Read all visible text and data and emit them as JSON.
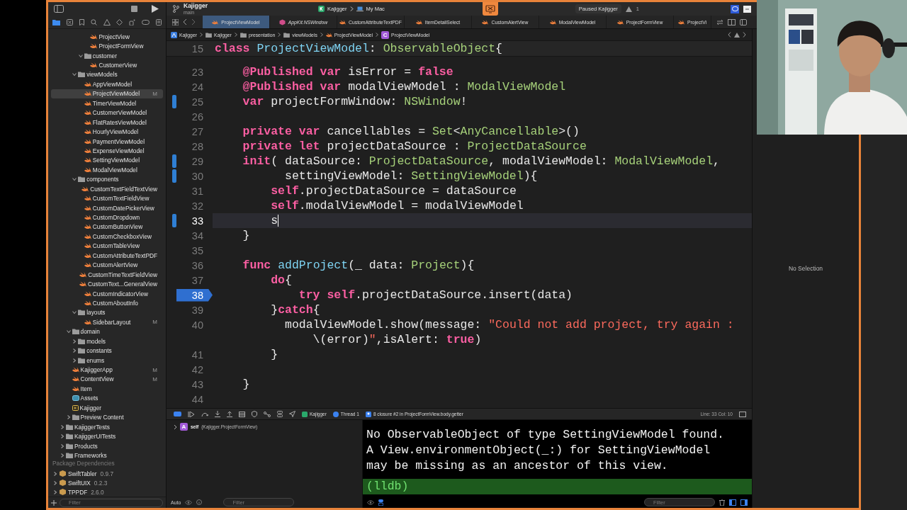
{
  "toolbar": {
    "project": "Kajigger",
    "branch": "main",
    "scheme": "Kajigger",
    "destination": "My Mac",
    "status": "Paused Kajigger",
    "warnings": "1"
  },
  "navigator": {
    "tree": [
      {
        "children": [
          {
            "children": [
              {
                "children": [
                  {
                    "children": [
                      {
                        "name": "ProjectView",
                        "kind": "swift",
                        "selected": false
                      },
                      {
                        "name": "ProjectFormView",
                        "kind": "swift",
                        "selected": false
                      }
                    ]
                  },
                  {
                    "name": "customer",
                    "kind": "folder",
                    "expanded": true,
                    "selected": false,
                    "children": [
                      {
                        "name": "CustomerView",
                        "kind": "swift",
                        "selected": false
                      }
                    ]
                  }
                ]
              },
              {
                "name": "viewModels",
                "kind": "folder",
                "expanded": true,
                "selected": false,
                "children": [
                  {
                    "name": "AppViewModel",
                    "kind": "swift",
                    "selected": false
                  },
                  {
                    "name": "ProjectViewModel",
                    "kind": "swift",
                    "selected": true,
                    "badge": "M"
                  },
                  {
                    "name": "TimerViewModel",
                    "kind": "swift",
                    "selected": false
                  },
                  {
                    "name": "CustomerViewModel",
                    "kind": "swift",
                    "selected": false
                  },
                  {
                    "name": "FlatRatesViewModel",
                    "kind": "swift",
                    "selected": false
                  },
                  {
                    "name": "HourlyViewModel",
                    "kind": "swift",
                    "selected": false
                  },
                  {
                    "name": "PaymentViewModel",
                    "kind": "swift",
                    "selected": false
                  },
                  {
                    "name": "ExpenseViewModel",
                    "kind": "swift",
                    "selected": false
                  },
                  {
                    "name": "SettingViewModel",
                    "kind": "swift",
                    "selected": false
                  },
                  {
                    "name": "ModalViewModel",
                    "kind": "swift",
                    "selected": false
                  }
                ]
              },
              {
                "name": "components",
                "kind": "folder",
                "expanded": true,
                "selected": false,
                "children": [
                  {
                    "name": "CustomTextFieldTextView",
                    "kind": "swift",
                    "selected": false
                  },
                  {
                    "name": "CustomTextFieldView",
                    "kind": "swift",
                    "selected": false
                  },
                  {
                    "name": "CustomDatePickerView",
                    "kind": "swift",
                    "selected": false
                  },
                  {
                    "name": "CustomDropdown",
                    "kind": "swift",
                    "selected": false
                  },
                  {
                    "name": "CustomButtonView",
                    "kind": "swift",
                    "selected": false
                  },
                  {
                    "name": "CustomCheckboxView",
                    "kind": "swift",
                    "selected": false
                  },
                  {
                    "name": "CustomTableView",
                    "kind": "swift",
                    "selected": false
                  },
                  {
                    "name": "CustomAttributeTextPDF",
                    "kind": "swift",
                    "selected": false
                  },
                  {
                    "name": "CustomAlertView",
                    "kind": "swift",
                    "selected": false
                  },
                  {
                    "name": "CustomTimeTextFieldView",
                    "kind": "swift",
                    "selected": false
                  },
                  {
                    "name": "CustomText...GeneralView",
                    "kind": "swift",
                    "selected": false
                  },
                  {
                    "name": "CustomIndicatorView",
                    "kind": "swift",
                    "selected": false
                  },
                  {
                    "name": "CustomAboutInfo",
                    "kind": "swift",
                    "selected": false
                  }
                ]
              },
              {
                "name": "layouts",
                "kind": "folder",
                "expanded": true,
                "selected": false,
                "children": [
                  {
                    "name": "SidebarLayout",
                    "kind": "swift",
                    "selected": false,
                    "badge": "M"
                  }
                ]
              }
            ]
          },
          {
            "name": "domain",
            "kind": "folder",
            "expanded": true,
            "selected": false,
            "children": [
              {
                "name": "models",
                "kind": "folder",
                "expanded": false,
                "selected": false
              },
              {
                "name": "constants",
                "kind": "folder",
                "expanded": false,
                "selected": false
              },
              {
                "name": "enums",
                "kind": "folder",
                "expanded": false,
                "selected": false
              }
            ]
          },
          {
            "name": "KajiggerApp",
            "kind": "swift",
            "selected": false,
            "badge": "M"
          },
          {
            "name": "ContentView",
            "kind": "swift",
            "selected": false,
            "badge": "M"
          },
          {
            "name": "Item",
            "kind": "swift",
            "selected": false
          },
          {
            "name": "Assets",
            "kind": "assets",
            "selected": false
          },
          {
            "name": "Kajigger",
            "kind": "config",
            "selected": false
          },
          {
            "name": "Preview Content",
            "kind": "folder",
            "expanded": false,
            "selected": false
          }
        ]
      },
      {
        "name": "KajiggerTests",
        "kind": "folder",
        "expanded": false,
        "selected": false
      },
      {
        "name": "KajiggerUITests",
        "kind": "folder",
        "expanded": false,
        "selected": false
      },
      {
        "name": "Products",
        "kind": "folder",
        "expanded": false,
        "selected": false
      },
      {
        "name": "Frameworks",
        "kind": "folder",
        "expanded": false,
        "selected": false
      }
    ],
    "packages_title": "Package Dependencies",
    "packages": [
      {
        "name": "SwiftTabler",
        "version": "0.9.7"
      },
      {
        "name": "SwiftUIX",
        "version": "0.2.3"
      },
      {
        "name": "TPPDF",
        "version": "2.6.0"
      }
    ],
    "filter": {
      "placeholder": "Filter"
    }
  },
  "tabs": [
    {
      "label": "ProjectViewModel",
      "kind": "swift",
      "selected": true
    },
    {
      "label": "AppKit.NSWindow",
      "kind": "interface",
      "selected": false
    },
    {
      "label": "CustomAttributeTextPDF",
      "kind": "swift",
      "selected": false
    },
    {
      "label": "ItemDetailSelect",
      "kind": "swift",
      "selected": false
    },
    {
      "label": "CustomAlertView",
      "kind": "swift",
      "selected": false
    },
    {
      "label": "ModalViewModel",
      "kind": "swift",
      "selected": false
    },
    {
      "label": "ProjectFormView",
      "kind": "swift",
      "selected": false
    },
    {
      "label": "ProjectVi",
      "kind": "swift",
      "selected": false
    }
  ],
  "breadcrumbs": [
    {
      "label": "Kajigger",
      "kind": "project"
    },
    {
      "label": "Kajigger",
      "kind": "folder"
    },
    {
      "label": "presentation",
      "kind": "folder"
    },
    {
      "label": "viewModels",
      "kind": "folder"
    },
    {
      "label": "ProjectViewModel",
      "kind": "swift"
    },
    {
      "label": "ProjectViewModel",
      "kind": "class",
      "badge": "C"
    }
  ],
  "code": {
    "sticky_line": {
      "number": "15",
      "tokens": [
        {
          "text": "class ",
          "kind": "kw"
        },
        {
          "text": "ProjectViewModel",
          "kind": "decl"
        },
        {
          "text": ": ",
          "kind": "plain"
        },
        {
          "text": "ObservableObject",
          "kind": "type"
        },
        {
          "text": "{",
          "kind": "plain"
        }
      ]
    },
    "lines": [
      {
        "number": "23",
        "changed": false,
        "breakpoint": false,
        "current": false,
        "tokens": [
          {
            "text": "    @Published var",
            "kind": "kw"
          },
          {
            "text": " isError = ",
            "kind": "plain"
          },
          {
            "text": "false",
            "kind": "kw"
          }
        ]
      },
      {
        "number": "24",
        "changed": false,
        "breakpoint": false,
        "current": false,
        "tokens": [
          {
            "text": "    @Published var",
            "kind": "kw"
          },
          {
            "text": " modalViewModel : ",
            "kind": "plain"
          },
          {
            "text": "ModalViewModel",
            "kind": "type"
          }
        ]
      },
      {
        "number": "25",
        "changed": true,
        "breakpoint": false,
        "current": false,
        "tokens": [
          {
            "text": "    var",
            "kind": "kw"
          },
          {
            "text": " projectFormWindow: ",
            "kind": "plain"
          },
          {
            "text": "NSWindow",
            "kind": "type"
          },
          {
            "text": "!",
            "kind": "plain"
          }
        ]
      },
      {
        "number": "26",
        "changed": false,
        "breakpoint": false,
        "current": false
      },
      {
        "number": "27",
        "changed": false,
        "breakpoint": false,
        "current": false,
        "tokens": [
          {
            "text": "    private var",
            "kind": "kw"
          },
          {
            "text": " cancellables = ",
            "kind": "plain"
          },
          {
            "text": "Set",
            "kind": "type"
          },
          {
            "text": "<",
            "kind": "plain"
          },
          {
            "text": "AnyCancellable",
            "kind": "type"
          },
          {
            "text": ">()",
            "kind": "plain"
          }
        ]
      },
      {
        "number": "28",
        "changed": false,
        "breakpoint": false,
        "current": false,
        "tokens": [
          {
            "text": "    private let",
            "kind": "kw"
          },
          {
            "text": " projectDataSource : ",
            "kind": "plain"
          },
          {
            "text": "ProjectDataSource",
            "kind": "type"
          }
        ]
      },
      {
        "number": "29",
        "changed": true,
        "breakpoint": false,
        "current": false,
        "tokens": [
          {
            "text": "    init",
            "kind": "kw"
          },
          {
            "text": "( dataSource: ",
            "kind": "plain"
          },
          {
            "text": "ProjectDataSource",
            "kind": "type"
          },
          {
            "text": ", modalViewModel: ",
            "kind": "plain"
          },
          {
            "text": "ModalViewModel",
            "kind": "type"
          },
          {
            "text": ",",
            "kind": "plain"
          }
        ]
      },
      {
        "number": "30",
        "changed": true,
        "breakpoint": false,
        "current": false,
        "tokens": [
          {
            "text": "          settingViewModel: ",
            "kind": "plain"
          },
          {
            "text": "SettingViewModel",
            "kind": "type"
          },
          {
            "text": "){",
            "kind": "plain"
          }
        ]
      },
      {
        "number": "31",
        "changed": false,
        "breakpoint": false,
        "current": false,
        "tokens": [
          {
            "text": "        self",
            "kind": "kw"
          },
          {
            "text": ".projectDataSource = dataSource",
            "kind": "plain"
          }
        ]
      },
      {
        "number": "32",
        "changed": false,
        "breakpoint": false,
        "current": false,
        "tokens": [
          {
            "text": "        self",
            "kind": "kw"
          },
          {
            "text": ".modalViewModel = modalViewModel",
            "kind": "plain"
          }
        ]
      },
      {
        "number": "33",
        "changed": true,
        "breakpoint": false,
        "current": true,
        "tokens": [
          {
            "text": "        s",
            "kind": "plain"
          }
        ]
      },
      {
        "number": "34",
        "changed": false,
        "breakpoint": false,
        "current": false,
        "tokens": [
          {
            "text": "    }",
            "kind": "plain"
          }
        ]
      },
      {
        "number": "35",
        "changed": false,
        "breakpoint": false,
        "current": false
      },
      {
        "number": "36",
        "changed": false,
        "breakpoint": false,
        "current": false,
        "tokens": [
          {
            "text": "    func ",
            "kind": "kw"
          },
          {
            "text": "addProject",
            "kind": "decl"
          },
          {
            "text": "(_ data: ",
            "kind": "plain"
          },
          {
            "text": "Project",
            "kind": "type"
          },
          {
            "text": "){",
            "kind": "plain"
          }
        ]
      },
      {
        "number": "37",
        "changed": false,
        "breakpoint": false,
        "current": false,
        "tokens": [
          {
            "text": "        do",
            "kind": "kw"
          },
          {
            "text": "{",
            "kind": "plain"
          }
        ]
      },
      {
        "number": "38",
        "changed": false,
        "breakpoint": true,
        "current": false,
        "tokens": [
          {
            "text": "            try self",
            "kind": "kw"
          },
          {
            "text": ".projectDataSource.insert(data)",
            "kind": "plain"
          }
        ]
      },
      {
        "number": "39",
        "changed": false,
        "breakpoint": false,
        "current": false,
        "tokens": [
          {
            "text": "        }",
            "kind": "plain"
          },
          {
            "text": "catch",
            "kind": "kw"
          },
          {
            "text": "{",
            "kind": "plain"
          }
        ]
      },
      {
        "number": "40",
        "changed": false,
        "breakpoint": false,
        "current": false,
        "tokens": [
          {
            "text": "          modalViewModel.show(message: ",
            "kind": "plain"
          },
          {
            "text": "\"Could not add project, try again :",
            "kind": "str"
          }
        ],
        "wrap": [
          {
            "text": "              \\(error)",
            "kind": "plain"
          },
          {
            "text": "\"",
            "kind": "str"
          },
          {
            "text": ",isAlert: ",
            "kind": "plain"
          },
          {
            "text": "true",
            "kind": "kw"
          },
          {
            "text": ")",
            "kind": "plain"
          }
        ]
      },
      {
        "number": "41",
        "changed": false,
        "breakpoint": false,
        "current": false,
        "tokens": [
          {
            "text": "        }",
            "kind": "plain"
          }
        ]
      },
      {
        "number": "42",
        "changed": false,
        "breakpoint": false,
        "current": false
      },
      {
        "number": "43",
        "changed": false,
        "breakpoint": false,
        "current": false,
        "tokens": [
          {
            "text": "    }",
            "kind": "plain"
          }
        ]
      },
      {
        "number": "44",
        "changed": false,
        "breakpoint": false,
        "current": false
      }
    ]
  },
  "debug_bar": {
    "target": "Kajigger",
    "thread": "Thread 1",
    "frame": "8 closure #2 in ProjectFormView.body.getter",
    "position": "Line: 33  Col: 10"
  },
  "variables": [
    {
      "badge": "A",
      "name": "self",
      "type": "(Kajigger.ProjectFormView)",
      "expanded": false
    }
  ],
  "variables_scope": "Auto",
  "variables_filter": {
    "placeholder": "Filter"
  },
  "console": {
    "lines": [
      "No ObservableObject of type SettingViewModel found.",
      "A View.environmentObject(_:) for SettingViewModel",
      "may be missing as an ancestor of this view."
    ],
    "prompt": "(lldb)",
    "filter": {
      "placeholder": "Filter"
    }
  },
  "inspector": {
    "message": "No Selection"
  }
}
